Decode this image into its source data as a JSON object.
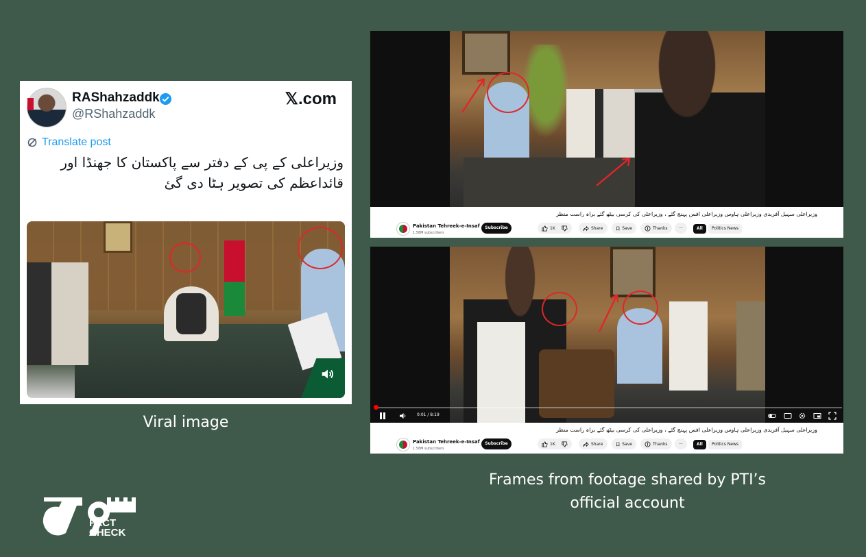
{
  "tweet": {
    "display_name": "RAShahzaddk",
    "handle": "@RShahzaddk",
    "brand": "𝕏.com",
    "translate_label": "Translate post",
    "text": "وزیراعلی کے پی کے دفتر سے پاکستان کا جھنڈا اور قائداعظم کی تصویر ہٹا دی گئ"
  },
  "video": {
    "title": "وزیراعلی سہیل آفریدی وزیراعلی ہاوس وزیراعلی افس پہنچ گئے ، وزیراعلی کی کرسی بیٹھ گئے براہ راست منظر",
    "channel": "Pakistan Tehreek-e-Insaf",
    "subscribers": "1.58M subscribers",
    "subscribe_label": "Subscribe",
    "likes": "1K",
    "share_label": "Share",
    "save_label": "Save",
    "thanks_label": "Thanks",
    "more_label": "···",
    "chip_all": "All",
    "chip_politics": "Politics News",
    "time": "0:01 / 8:19",
    "progress": 0.002
  },
  "captions": {
    "viral": "Viral image",
    "frames": "Frames from footage shared by PTI’s official account"
  },
  "logo": {
    "fact": "FACT",
    "check": "CHECK"
  },
  "colors": {
    "background": "#3f5a4a",
    "annotation_red": "#e0262a",
    "x_blue": "#1d9bf0",
    "youtube_red": "#ff0000"
  }
}
